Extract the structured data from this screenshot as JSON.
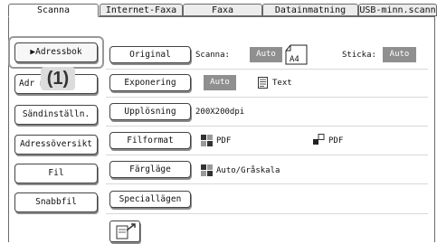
{
  "tabs": [
    "Scanna",
    "Internet-Faxa",
    "Faxa",
    "Datainmatning",
    "USB-minn.scann"
  ],
  "sidebar": {
    "items": [
      {
        "label": "▶Adressbok"
      },
      {
        "label": "Adr      n."
      },
      {
        "label": "Sändinställn."
      },
      {
        "label": "Adressöversikt"
      },
      {
        "label": "Fil"
      },
      {
        "label": "Snabbfil"
      }
    ]
  },
  "callout": "(1)",
  "settings": {
    "original": {
      "button": "Original",
      "scan_label": "Scanna:",
      "scan_value": "Auto",
      "size": "A4",
      "send_label": "Sticka:",
      "send_value": "Auto"
    },
    "exposure": {
      "button": "Exponering",
      "value": "Auto",
      "mode": "Text"
    },
    "resolution": {
      "button": "Upplösning",
      "value": "200X200dpi"
    },
    "file_format": {
      "button": "Filformat",
      "value1": "PDF",
      "value2": "PDF"
    },
    "color_mode": {
      "button": "Färgläge",
      "value": "Auto/Gråskala"
    },
    "special": {
      "button": "Speciallägen"
    }
  },
  "icons": {
    "size": "document-a4-icon",
    "mode": "text-document-icon",
    "format": "file-type-icon",
    "color": "color-mode-icon",
    "preview": "scan-preview-icon"
  },
  "colors": {
    "highlight_bg": "#8f8f8f",
    "border": "#444444"
  }
}
